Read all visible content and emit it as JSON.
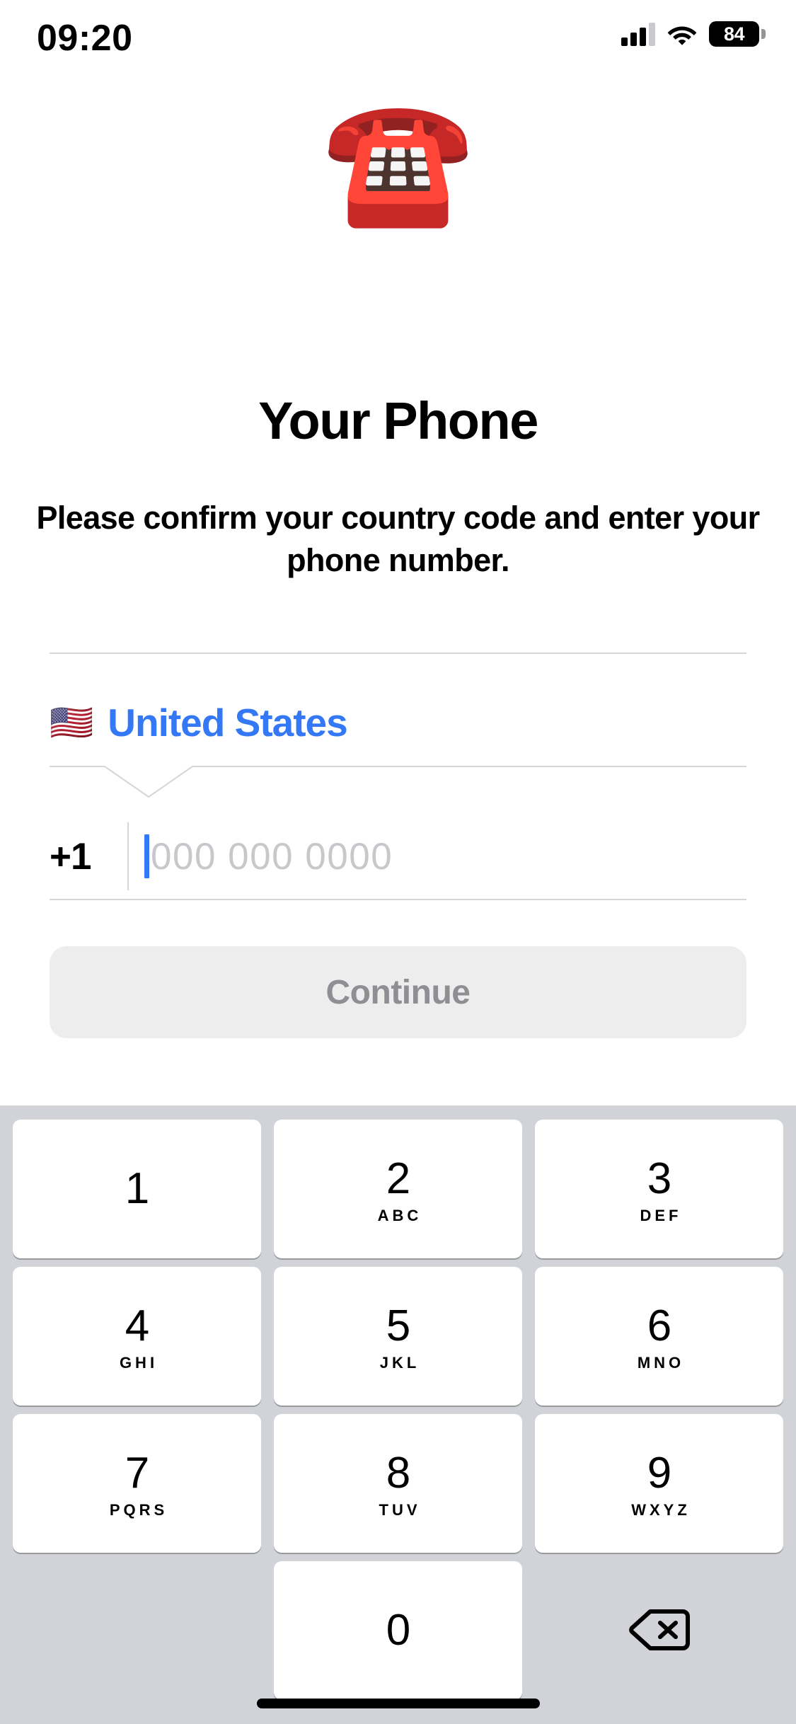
{
  "status_bar": {
    "time": "09:20",
    "battery_percent": "84",
    "icons": [
      "cellular-signal-icon",
      "wifi-icon",
      "battery-icon"
    ]
  },
  "hero": {
    "emoji": "☎️",
    "emoji_name": "telephone-emoji"
  },
  "header": {
    "title": "Your Phone",
    "subtitle": "Please confirm your country code and enter your phone number."
  },
  "form": {
    "country": {
      "flag": "🇺🇸",
      "name": "United States",
      "accent_color": "#3478f6"
    },
    "phone": {
      "country_code": "+1",
      "value": "",
      "placeholder": "000 000 0000"
    }
  },
  "actions": {
    "continue_label": "Continue",
    "continue_enabled": false,
    "continue_bg": "#ededed",
    "continue_text_color": "#8e8e93"
  },
  "keypad": {
    "background": "#d1d3d9",
    "rows": [
      [
        {
          "digit": "1",
          "letters": ""
        },
        {
          "digit": "2",
          "letters": "ABC"
        },
        {
          "digit": "3",
          "letters": "DEF"
        }
      ],
      [
        {
          "digit": "4",
          "letters": "GHI"
        },
        {
          "digit": "5",
          "letters": "JKL"
        },
        {
          "digit": "6",
          "letters": "MNO"
        }
      ],
      [
        {
          "digit": "7",
          "letters": "PQRS"
        },
        {
          "digit": "8",
          "letters": "TUV"
        },
        {
          "digit": "9",
          "letters": "WXYZ"
        }
      ],
      [
        {
          "digit": "",
          "letters": ""
        },
        {
          "digit": "0",
          "letters": ""
        },
        {
          "digit": "backspace",
          "letters": ""
        }
      ]
    ]
  }
}
